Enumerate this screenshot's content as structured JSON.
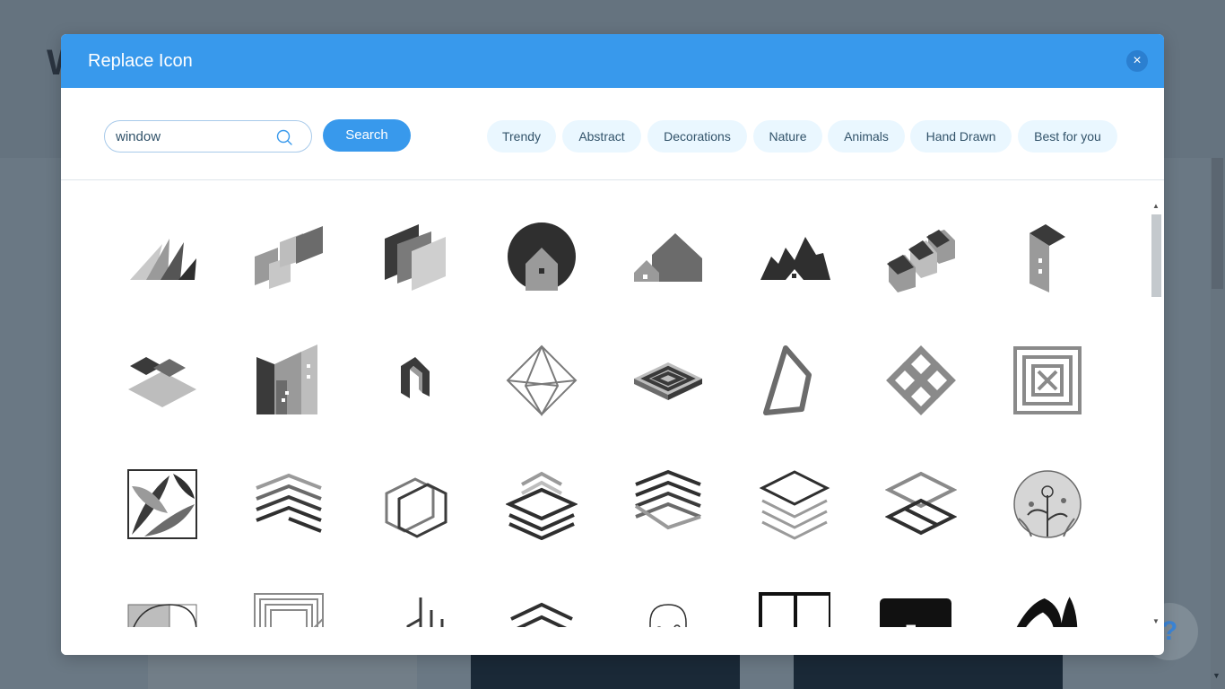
{
  "background": {
    "title_fragment": "W",
    "help_glyph": "?"
  },
  "modal": {
    "title": "Replace Icon",
    "close_glyph": "×"
  },
  "search": {
    "value": "window",
    "button_label": "Search"
  },
  "categories": [
    "Trendy",
    "Abstract",
    "Decorations",
    "Nature",
    "Animals",
    "Hand Drawn",
    "Best for you"
  ],
  "icons": {
    "row1": [
      "slanted-peaks-icon",
      "offset-parallelograms-icon",
      "layered-panels-icon",
      "house-in-circle-icon",
      "houses-hill-icon",
      "mountain-house-icon",
      "row-houses-icon",
      "tall-building-icon"
    ],
    "row2": [
      "stacked-diamonds-icon",
      "city-buildings-icon",
      "interlocked-n-icon",
      "wire-octahedron-icon",
      "isometric-maze-icon",
      "tilted-frame-icon",
      "diamond-lattice-icon",
      "square-maze-x-icon"
    ],
    "row3": [
      "palm-leaves-square-icon",
      "chevron-stripes-icon",
      "overlapping-outlines-icon",
      "layered-chevrons-icon",
      "zigzag-layers-icon",
      "stacked-outline-diamonds-icon",
      "linked-frames-icon",
      "floral-circle-icon"
    ],
    "row4": [
      "golden-ratio-icon",
      "striped-square-icon",
      "vertical-bars-icon",
      "double-chevron-icon",
      "arched-tree-window-icon",
      "window-frame-icon",
      "black-screen-icon",
      "eye-leaf-icon"
    ]
  },
  "scrollbar": {
    "up_glyph": "▲",
    "down_glyph": "▼"
  }
}
